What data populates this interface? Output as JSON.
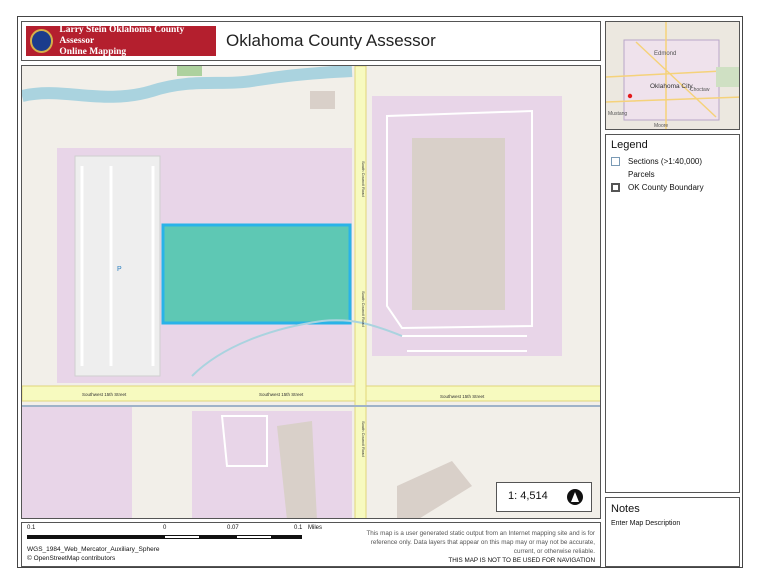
{
  "header": {
    "logo_line1": "Larry Stein Oklahoma County Assessor",
    "logo_line2": "Online Mapping",
    "title": "Oklahoma County Assessor"
  },
  "map": {
    "scale": "1: 4,514",
    "labels": {
      "parking": "P",
      "street_h_left": "Southwest 15th Street",
      "street_h_mid": "Southwest 15th Street",
      "street_h_right": "Southwest 15th Street",
      "street_v_upper": "South Council Road",
      "street_v_mid": "South Council Road",
      "street_v_lower": "South Council Road"
    },
    "colors": {
      "selected_parcel": "#5ec8b4",
      "selected_outline": "#29b3e8",
      "parcel_fill": "#e8d5e8"
    }
  },
  "inset": {
    "labels": {
      "edmond": "Edmond",
      "oklahoma_city": "Oklahoma City",
      "choctaw": "Choctaw",
      "mustang": "Mustang",
      "moore": "Moore"
    }
  },
  "legend": {
    "title": "Legend",
    "items": [
      "Sections (>1:40,000)",
      "Parcels",
      "OK County Boundary"
    ]
  },
  "notes": {
    "title": "Notes",
    "text": "Enter Map Description"
  },
  "footer": {
    "scalebar_labels": [
      "0.1",
      "0",
      "0.07",
      "0.1",
      "Miles"
    ],
    "projection": "WGS_1984_Web_Mercator_Auxiliary_Sphere",
    "attribution": "© OpenStreetMap contributors",
    "disclaimer": "This map is a user generated static output from an Internet mapping site and is for reference only. Data layers that appear on this map may or may not be accurate, current, or otherwise reliable.",
    "navigation_warning": "THIS MAP IS NOT TO BE USED FOR NAVIGATION"
  }
}
